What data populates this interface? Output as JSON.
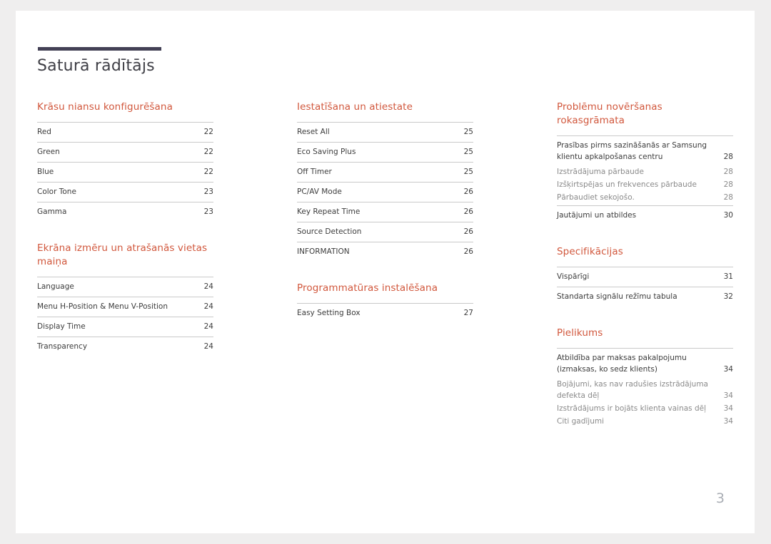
{
  "document": {
    "title": "Saturā rādītājs",
    "folio": "3",
    "accent_color": "#d1573c",
    "rule_color": "#434055"
  },
  "columns": [
    {
      "sections": [
        {
          "heading": "Krāsu niansu konfigurēšana",
          "entries": [
            {
              "label": "Red",
              "page": "22",
              "level": "main"
            },
            {
              "label": "Green",
              "page": "22",
              "level": "main"
            },
            {
              "label": "Blue",
              "page": "22",
              "level": "main"
            },
            {
              "label": "Color Tone",
              "page": "23",
              "level": "main"
            },
            {
              "label": "Gamma",
              "page": "23",
              "level": "main"
            }
          ]
        },
        {
          "heading": "Ekrāna izmēru un atrašanās vietas maiņa",
          "entries": [
            {
              "label": "Language",
              "page": "24",
              "level": "main"
            },
            {
              "label": "Menu H-Position & Menu V-Position",
              "page": "24",
              "level": "main"
            },
            {
              "label": "Display Time",
              "page": "24",
              "level": "main"
            },
            {
              "label": "Transparency",
              "page": "24",
              "level": "main"
            }
          ]
        }
      ]
    },
    {
      "sections": [
        {
          "heading": "Iestatīšana un atiestate",
          "entries": [
            {
              "label": "Reset All",
              "page": "25",
              "level": "main"
            },
            {
              "label": "Eco Saving Plus",
              "page": "25",
              "level": "main"
            },
            {
              "label": "Off Timer",
              "page": "25",
              "level": "main"
            },
            {
              "label": "PC/AV Mode",
              "page": "26",
              "level": "main"
            },
            {
              "label": "Key Repeat Time",
              "page": "26",
              "level": "main"
            },
            {
              "label": "Source Detection",
              "page": "26",
              "level": "main"
            },
            {
              "label": "INFORMATION",
              "page": "26",
              "level": "main"
            }
          ]
        },
        {
          "heading": "Programmatūras instalēšana",
          "entries": [
            {
              "label": "Easy Setting Box",
              "page": "27",
              "level": "main"
            }
          ]
        }
      ]
    },
    {
      "sections": [
        {
          "heading": "Problēmu novēršanas rokasgrāmata",
          "entries": [
            {
              "label": "Prasības pirms sazināšanās ar Samsung klientu apkalpošanas centru",
              "page": "28",
              "level": "main"
            },
            {
              "label": "Izstrādājuma pārbaude",
              "page": "28",
              "level": "sub"
            },
            {
              "label": "Izšķirtspējas un frekvences pārbaude",
              "page": "28",
              "level": "sub"
            },
            {
              "label": "Pārbaudiet sekojošo.",
              "page": "28",
              "level": "sub"
            },
            {
              "label": "Jautājumi un atbildes",
              "page": "30",
              "level": "main"
            }
          ]
        },
        {
          "heading": "Specifikācijas",
          "entries": [
            {
              "label": "Vispārīgi",
              "page": "31",
              "level": "main"
            },
            {
              "label": "Standarta signālu režīmu tabula",
              "page": "32",
              "level": "main"
            }
          ]
        },
        {
          "heading": "Pielikums",
          "entries": [
            {
              "label": "Atbildība par maksas pakalpojumu (izmaksas, ko sedz klients)",
              "page": "34",
              "level": "main"
            },
            {
              "label": "Bojājumi, kas nav radušies izstrādājuma defekta dēļ",
              "page": "34",
              "level": "sub"
            },
            {
              "label": "Izstrādājums ir bojāts klienta vainas dēļ",
              "page": "34",
              "level": "sub"
            },
            {
              "label": "Citi gadījumi",
              "page": "34",
              "level": "sub"
            }
          ]
        }
      ]
    }
  ]
}
